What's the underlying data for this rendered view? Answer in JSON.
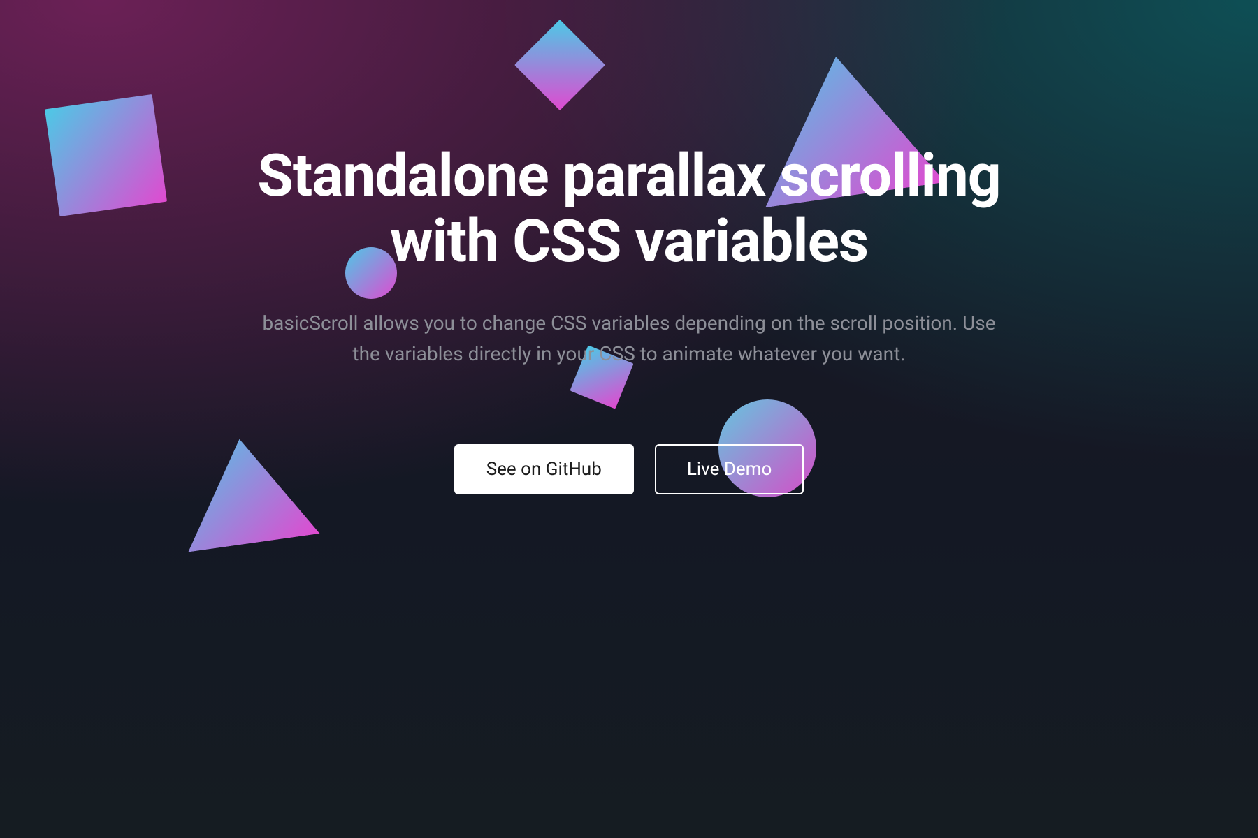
{
  "hero": {
    "title_line1": "Standalone parallax scrolling",
    "title_line2": "with CSS variables",
    "subtitle": "basicScroll allows you to change CSS variables depending on the scroll position. Use the variables directly in your CSS to animate whatever you want."
  },
  "cta": {
    "primary_label": "See on GitHub",
    "secondary_label": "Live Demo"
  },
  "decor": {
    "gradient_from": "#4cc9e6",
    "gradient_to": "#e04ad0",
    "items": [
      {
        "name": "square-large-top-left",
        "kind": "square"
      },
      {
        "name": "diamond-top-center",
        "kind": "square"
      },
      {
        "name": "square-behind-cta",
        "kind": "square"
      },
      {
        "name": "circle-behind-subhead",
        "kind": "circle"
      },
      {
        "name": "circle-bottom-right",
        "kind": "circle"
      },
      {
        "name": "triangle-top-right",
        "kind": "triangle"
      },
      {
        "name": "triangle-bottom-left",
        "kind": "triangle"
      }
    ]
  }
}
